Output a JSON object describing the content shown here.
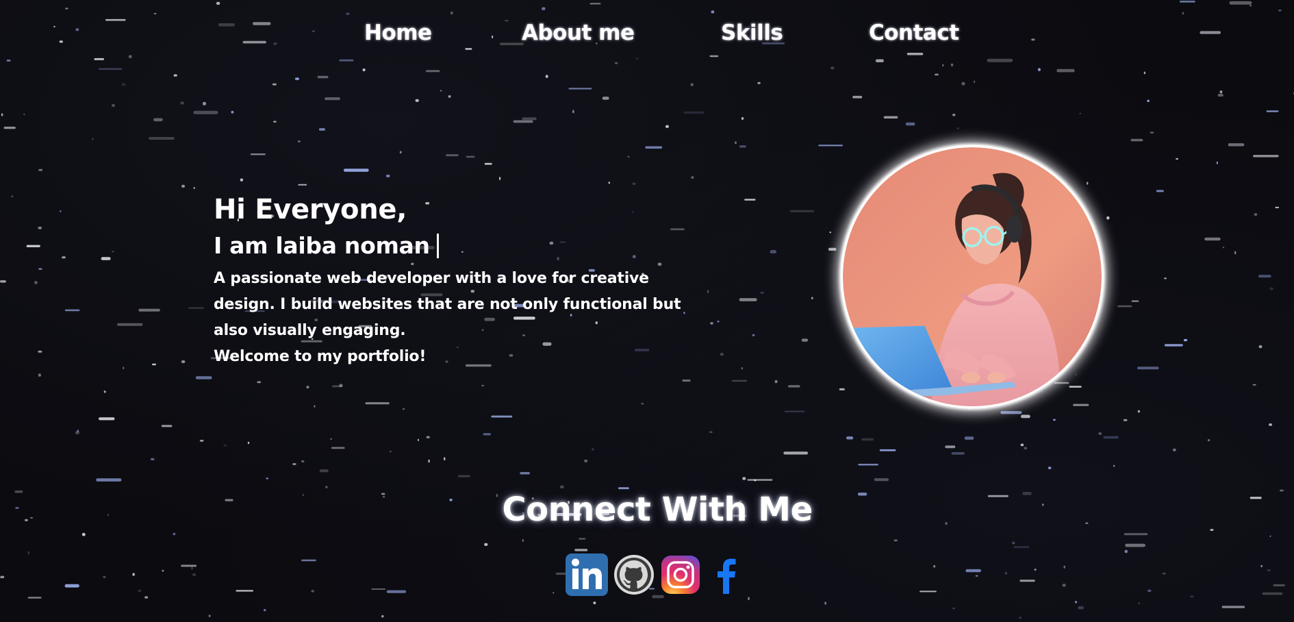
{
  "nav": {
    "home": "Home",
    "about": "About me",
    "skills": "Skills",
    "contact": "Contact"
  },
  "hero": {
    "greeting": "Hi Everyone,",
    "intro": "I am laiba noman",
    "bio": "A passionate web developer with a love for creative design. I build websites that are not only functional but also visually engaging.",
    "welcome": "Welcome to my portfolio!"
  },
  "profile_image": {
    "icon": "profile-photo-girl-with-laptop"
  },
  "connect": {
    "title": "Connect With Me",
    "icons": [
      "linkedin-icon",
      "github-icon",
      "instagram-icon",
      "facebook-icon"
    ]
  },
  "colors": {
    "background": "#0b0b10",
    "text": "#ffffff",
    "linkedin": "#2f6fb0",
    "facebook": "#1877f2",
    "avatar_bg": "#eb8e78"
  }
}
